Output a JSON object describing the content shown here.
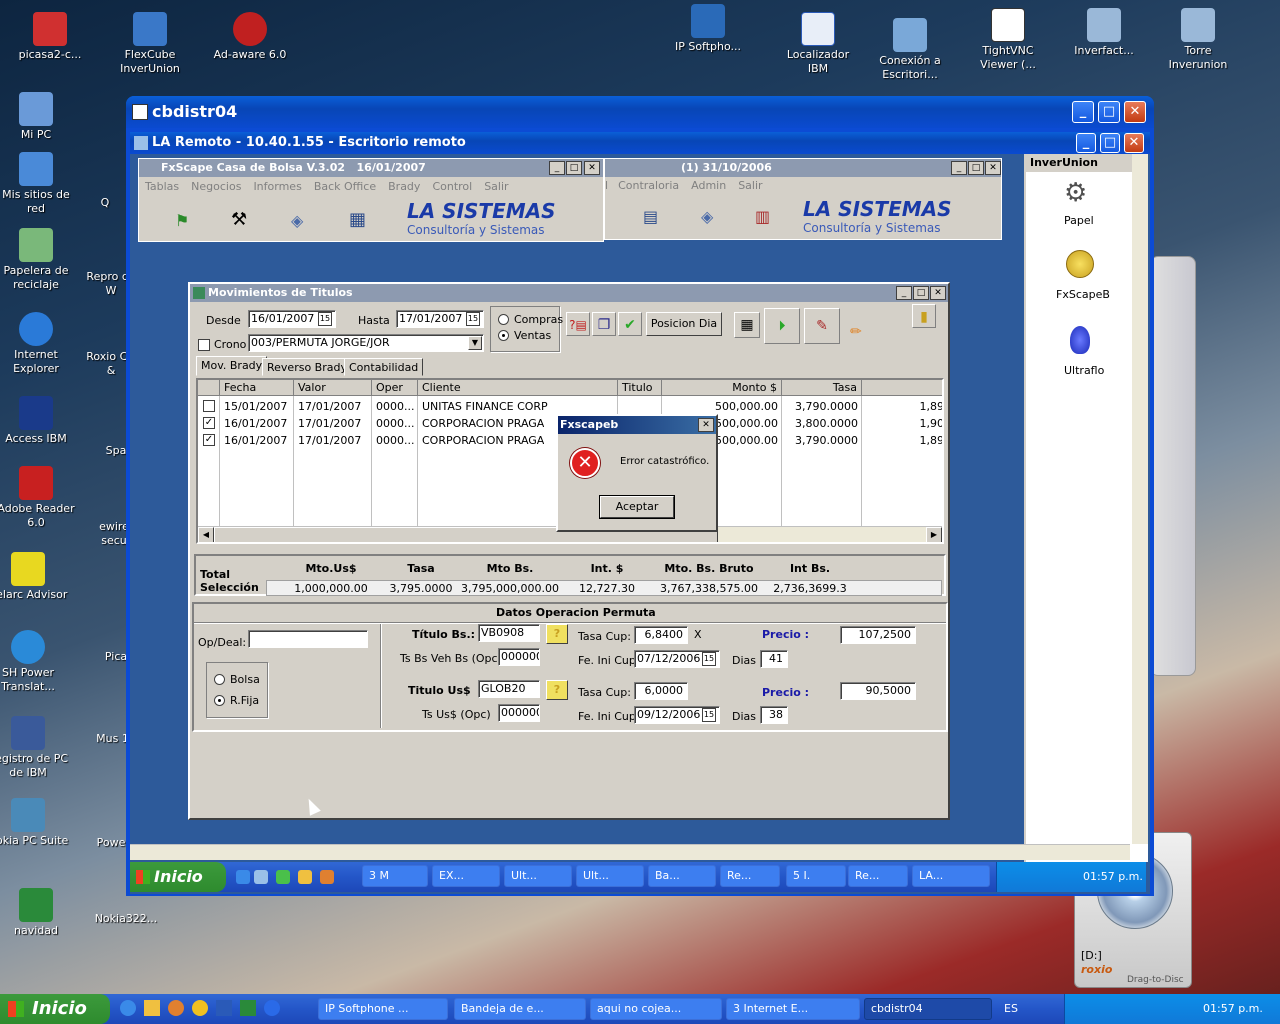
{
  "desktop": {
    "icons_top": [
      "picasa2-c...",
      "FlexCube InverUnion",
      "Ad-aware 6.0",
      "IP Softpho...",
      "Localizador IBM",
      "Conexión a Escritori...",
      "TightVNC Viewer (...",
      "Inverfact...",
      "Torre Inverunion"
    ],
    "icons_left": [
      "Mi PC",
      "Mis sitios de red",
      "Papelera de reciclaje",
      "Internet Explorer",
      "Access IBM",
      "Adobe Reader 6.0",
      "Belarc Advisor",
      "SH Power Translat...",
      "Registro de PC de IBM",
      "Nokia PC Suite",
      "navidad"
    ],
    "icons_left2": [
      "Q",
      "Repro de W",
      "Roxio CD &",
      "Spa",
      "ewire secu",
      "Pica",
      "Mus 10",
      "Powe",
      "Nokia322..."
    ]
  },
  "outer_window": {
    "title": "cbdistr04"
  },
  "remote_window": {
    "title": "LA Remoto - 10.40.1.55 - Escritorio remoto"
  },
  "fxscape": {
    "title": "FxScape Casa de Bolsa  V.3.02",
    "date": "16/01/2007",
    "menu": [
      "Tablas",
      "Negocios",
      "Informes",
      "Back Office",
      "Brady",
      "Control",
      "Salir"
    ],
    "logo": "LA SISTEMAS",
    "logo_sub": "Consultoría y Sistemas"
  },
  "second_app": {
    "title": "(1)  31/10/2006",
    "menu": [
      "l",
      "Contraloria",
      "Admin",
      "Salir"
    ],
    "logo": "LA SISTEMAS",
    "logo_sub": "Consultoría y Sistemas"
  },
  "inverunion": {
    "title": "InverUnion",
    "items": [
      "Papel",
      "FxScapeB",
      "Ultraflo"
    ]
  },
  "mov": {
    "title": "Movimientos de Titulos",
    "desde_label": "Desde",
    "desde": "16/01/2007",
    "hasta_label": "Hasta",
    "hasta": "17/01/2007",
    "crono_label": "Crono",
    "crono": "003/PERMUTA JORGE/JOR",
    "compras": "Compras",
    "ventas": "Ventas",
    "posicion": "Posicion Dia",
    "tabs": [
      "Mov. Brady",
      "Reverso Brady",
      "Contabilidad"
    ],
    "columns": [
      "Fecha",
      "Valor",
      "Oper",
      "Cliente",
      "Titulo",
      "Monto $",
      "Tasa"
    ],
    "rows": [
      {
        "checked": false,
        "fecha": "15/01/2007",
        "valor": "17/01/2007",
        "oper": "0000...",
        "cliente": "UNITAS FINANCE CORP",
        "monto": "500,000.00",
        "tasa": "3,790.0000",
        "extra": "1,89"
      },
      {
        "checked": true,
        "fecha": "16/01/2007",
        "valor": "17/01/2007",
        "oper": "0000...",
        "cliente": "CORPORACION PRAGA",
        "monto": "500,000.00",
        "tasa": "3,800.0000",
        "extra": "1,90"
      },
      {
        "checked": true,
        "fecha": "16/01/2007",
        "valor": "17/01/2007",
        "oper": "0000...",
        "cliente": "CORPORACION PRAGA",
        "monto": "500,000.00",
        "tasa": "3,790.0000",
        "extra": "1,89"
      }
    ],
    "total": {
      "label1": "Total",
      "label2": "Selección",
      "headers": [
        "Mto.Us$",
        "Tasa",
        "Mto Bs.",
        "Int. $",
        "Mto. Bs. Bruto",
        "Int Bs."
      ],
      "values": [
        "1,000,000.00",
        "3,795.0000",
        "3,795,000,000.00",
        "12,727.30",
        "3,767,338,575.00",
        "2,736,3699.3"
      ]
    },
    "permuta": {
      "title": "Datos Operacion Permuta",
      "opdeal_label": "Op/Deal:",
      "bolsa": "Bolsa",
      "rfija": "R.Fija",
      "titulo_bs_label": "Título Bs.:",
      "titulo_bs": "VB0908",
      "tsbs_label": "Ts Bs Veh Bs (Opc)",
      "tsbs": "000000",
      "titulo_us_label": "Titulo Us$",
      "titulo_us": "GLOB20",
      "tsus_label": "Ts Us$  (Opc)",
      "tsus": "000000",
      "tasa_cup_label": "Tasa Cup:",
      "tasa_cup1": "6,8400",
      "tasa_cup2": "6,0000",
      "x_mark": "X",
      "fe_label": "Fe. Ini Cup",
      "fe1": "07/12/2006",
      "fe2": "09/12/2006",
      "dias_label": "Dias",
      "dias1": "41",
      "dias2": "38",
      "precio_label": "Precio :",
      "precio1": "107,2500",
      "precio2": "90,5000"
    }
  },
  "dialog": {
    "title": "Fxscapeb",
    "message": "Error catastrófico.",
    "ok": "Aceptar"
  },
  "inner_taskbar": {
    "start": "Inicio",
    "items": [
      "3 M",
      "EX...",
      "Ult...",
      "Ult...",
      "Ba...",
      "Re...",
      "5 I.",
      "Re...",
      "LA..."
    ],
    "clock": "01:57 p.m."
  },
  "roxio": {
    "drive": "[D:]",
    "brand": "roxio",
    "tag": "Drag-to-Disc"
  },
  "taskbar": {
    "start": "Inicio",
    "items": [
      "IP Softphone ...",
      "Bandeja de e...",
      "aqui no cojea...",
      "3 Internet E...",
      "cbdistr04"
    ],
    "lang": "ES",
    "clock": "01:57 p.m."
  }
}
